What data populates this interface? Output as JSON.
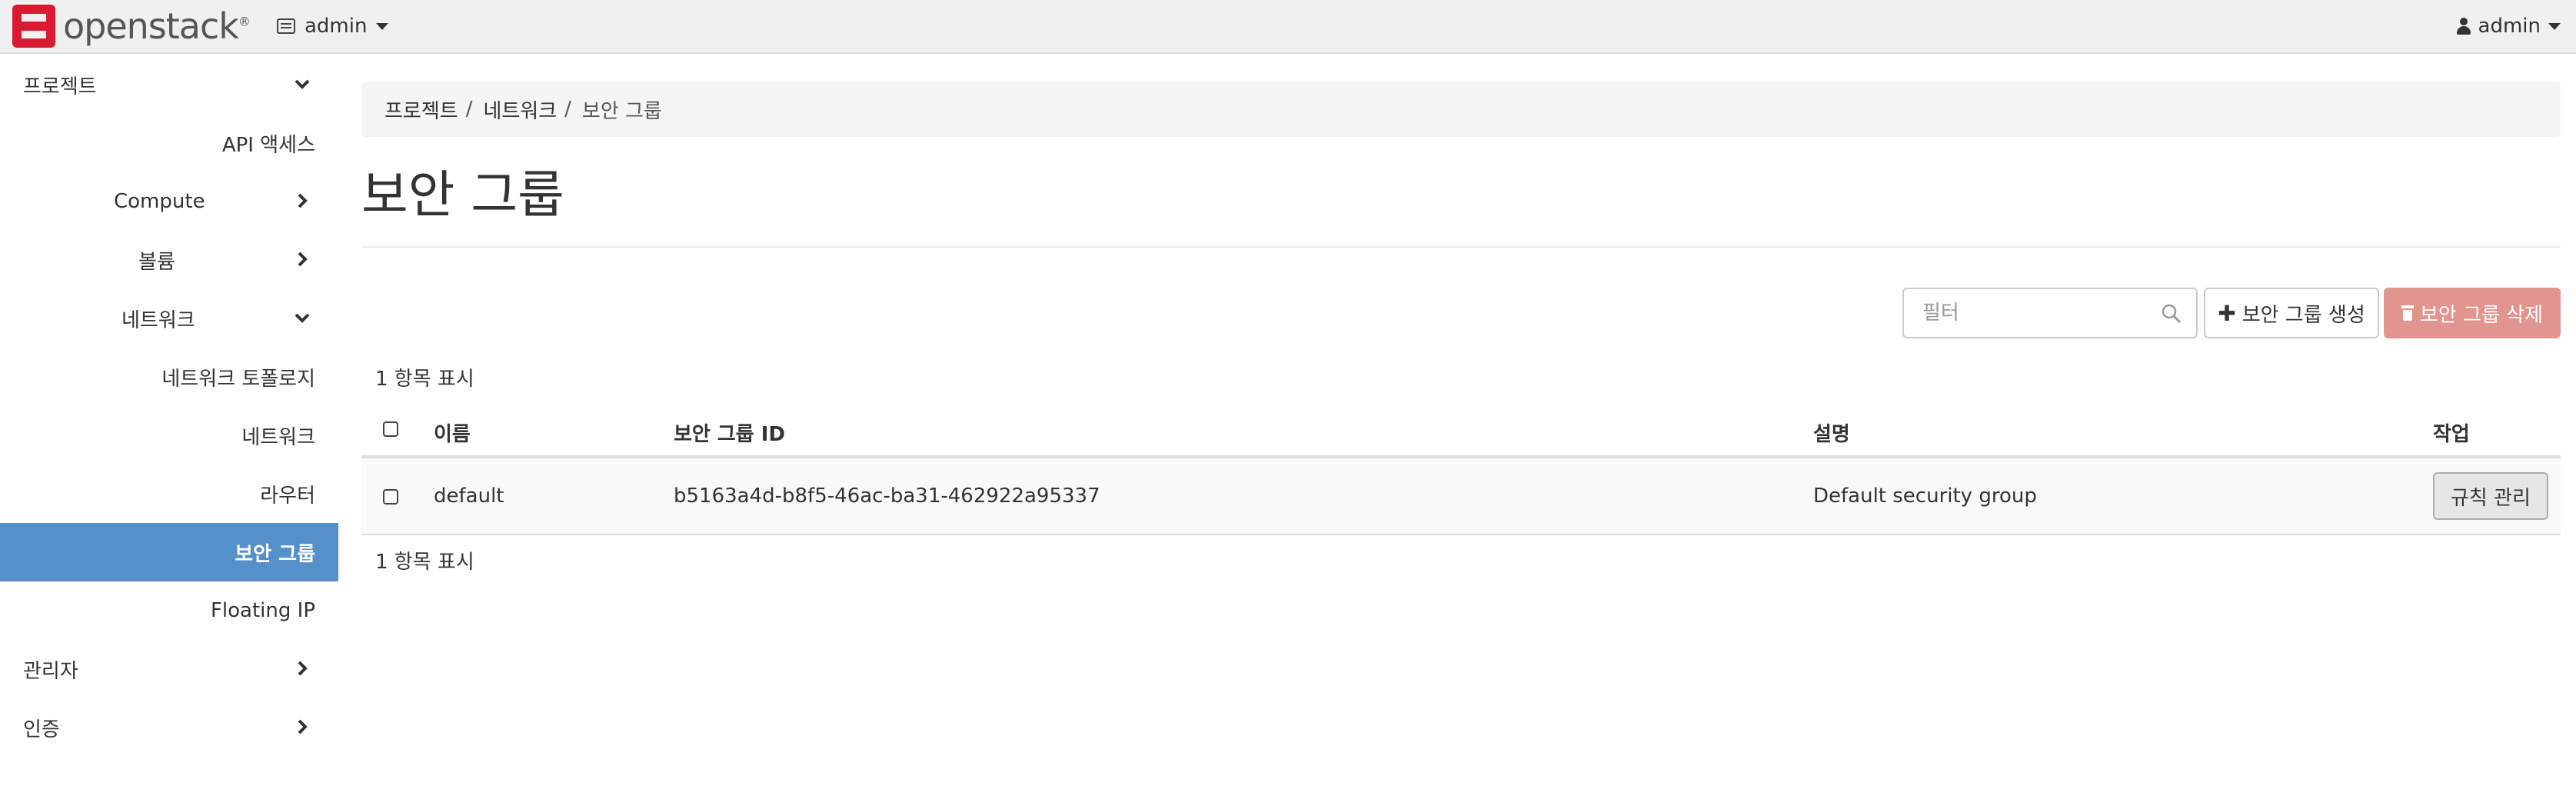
{
  "header": {
    "logo_text": "openstack",
    "logo_mark": "®",
    "project_label": "admin",
    "user_label": "admin"
  },
  "sidebar": {
    "items": [
      {
        "label": "프로젝트",
        "chevron": "down"
      },
      {
        "label": "API 액세스"
      },
      {
        "label": "Compute",
        "chevron": "right"
      },
      {
        "label": "볼륨",
        "chevron": "right"
      },
      {
        "label": "네트워크",
        "chevron": "down"
      },
      {
        "label": "네트워크 토폴로지"
      },
      {
        "label": "네트워크"
      },
      {
        "label": "라우터"
      },
      {
        "label": "보안 그룹",
        "active": true
      },
      {
        "label": "Floating IP"
      },
      {
        "label": "관리자",
        "chevron": "right"
      },
      {
        "label": "인증",
        "chevron": "right"
      }
    ]
  },
  "breadcrumb": {
    "items": [
      "프로젝트",
      "네트워크",
      "보안 그룹"
    ],
    "separator": "/"
  },
  "page": {
    "title": "보안 그룹"
  },
  "toolbar": {
    "filter_placeholder": "필터",
    "create_label": "보안 그룹 생성",
    "delete_label": "보안 그룹 삭제"
  },
  "table": {
    "count_top": "1 항목 표시",
    "count_bottom": "1 항목 표시",
    "columns": [
      "이름",
      "보안 그룹 ID",
      "설명",
      "작업"
    ],
    "rows": [
      {
        "name": "default",
        "id": "b5163a4d-b8f5-46ac-ba31-462922a95337",
        "description": "Default security group",
        "action": "규칙 관리"
      }
    ]
  },
  "colors": {
    "accent": "#5490ca",
    "danger_button": "#e2948f",
    "brand": "#da1a32"
  }
}
